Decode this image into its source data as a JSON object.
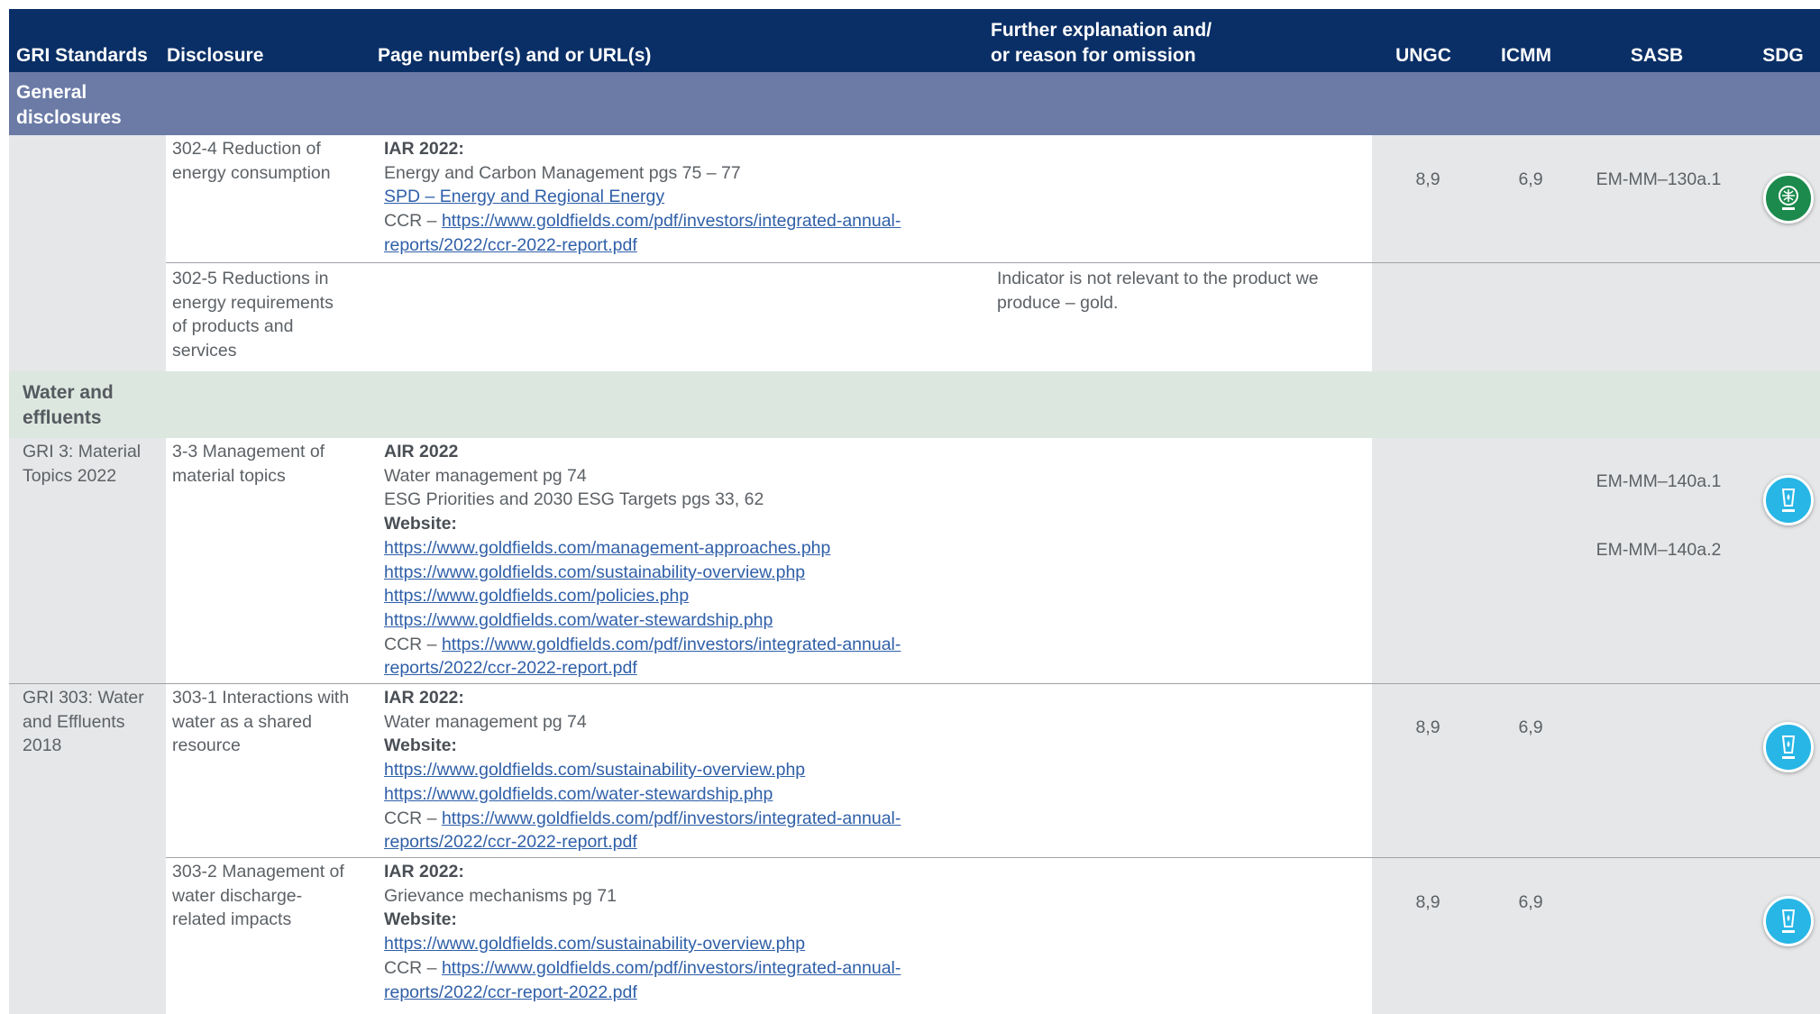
{
  "header": {
    "gri_standards": "GRI Standards",
    "disclosure": "Disclosure",
    "page_numbers": "Page number(s) and or URL(s)",
    "further_explanation_line1": "Further explanation and/",
    "further_explanation_line2": "or reason for omission",
    "ungc": "UNGC",
    "icmm": "ICMM",
    "sasb": "SASB",
    "sdg": "SDG"
  },
  "sections": {
    "general_line1": "General",
    "general_line2": "disclosures",
    "water_line1": "Water and",
    "water_line2": "effluents"
  },
  "rows": [
    {
      "disclosure": [
        "302-4 Reduction of",
        "energy consumption"
      ],
      "pages": [
        {
          "type": "bold",
          "text": "IAR 2022:"
        },
        {
          "type": "text",
          "text": "Energy and Carbon Management pgs 75 – 77"
        },
        {
          "type": "link",
          "text": "SPD – Energy and Regional Energy"
        },
        {
          "type": "ccr",
          "prefix": "CCR – ",
          "text": "https://www.goldfields.com/pdf/investors/integrated-annual-"
        },
        {
          "type": "link",
          "text": "reports/2022/ccr-2022-report.pdf"
        }
      ],
      "ungc": "8,9",
      "icmm": "6,9",
      "sasb": [
        "EM-MM–130a.1"
      ],
      "sdg_icon": "sdg-green-icon"
    },
    {
      "disclosure": [
        "302-5 Reductions in",
        "energy requirements",
        "of products and",
        "services"
      ],
      "explanation": [
        "Indicator is not relevant to the product we",
        "produce – gold."
      ]
    },
    {
      "gri": [
        "GRI 3: Material",
        "Topics 2022"
      ],
      "disclosure": [
        "3-3 Management of",
        "material topics"
      ],
      "pages": [
        {
          "type": "bold",
          "text": "AIR 2022"
        },
        {
          "type": "text",
          "text": "Water management pg 74"
        },
        {
          "type": "text",
          "text": "ESG Priorities and 2030 ESG Targets pgs 33, 62"
        },
        {
          "type": "bold",
          "text": "Website:"
        },
        {
          "type": "link",
          "text": "https://www.goldfields.com/management-approaches.php"
        },
        {
          "type": "link",
          "text": "https://www.goldfields.com/sustainability-overview.php"
        },
        {
          "type": "link",
          "text": "https://www.goldfields.com/policies.php"
        },
        {
          "type": "link",
          "text": "https://www.goldfields.com/water-stewardship.php"
        },
        {
          "type": "ccr",
          "prefix": "CCR – ",
          "text": "https://www.goldfields.com/pdf/investors/integrated-annual-"
        },
        {
          "type": "link",
          "text": "reports/2022/ccr-2022-report.pdf"
        }
      ],
      "sasb": [
        "EM-MM–140a.1",
        "EM-MM–140a.2"
      ],
      "sdg_icon": "sdg-blue-icon"
    },
    {
      "gri": [
        "GRI 303: Water",
        "and Effluents",
        "2018"
      ],
      "disclosure": [
        "303-1 Interactions with",
        "water as a shared",
        "resource"
      ],
      "pages": [
        {
          "type": "bold",
          "text": "IAR 2022:"
        },
        {
          "type": "text",
          "text": "Water management pg 74"
        },
        {
          "type": "bold",
          "text": "Website:"
        },
        {
          "type": "link",
          "text": "https://www.goldfields.com/sustainability-overview.php"
        },
        {
          "type": "link",
          "text": "https://www.goldfields.com/water-stewardship.php"
        },
        {
          "type": "ccr",
          "prefix": "CCR – ",
          "text": "https://www.goldfields.com/pdf/investors/integrated-annual-"
        },
        {
          "type": "link",
          "text": "reports/2022/ccr-2022-report.pdf"
        }
      ],
      "ungc": "8,9",
      "icmm": "6,9",
      "sdg_icon": "sdg-blue-icon"
    },
    {
      "disclosure": [
        "303-2 Management of",
        "water discharge-",
        "related impacts"
      ],
      "pages": [
        {
          "type": "bold",
          "text": "IAR 2022:"
        },
        {
          "type": "text",
          "text": "Grievance mechanisms pg 71"
        },
        {
          "type": "bold",
          "text": "Website:"
        },
        {
          "type": "link",
          "text": "https://www.goldfields.com/sustainability-overview.php"
        },
        {
          "type": "ccr",
          "prefix": "CCR – ",
          "text": "https://www.goldfields.com/pdf/investors/integrated-annual-"
        },
        {
          "type": "link",
          "text": "reports/2022/ccr-report-2022.pdf"
        }
      ],
      "ungc": "8,9",
      "icmm": "6,9",
      "sdg_icon": "sdg-blue-icon"
    }
  ],
  "colors": {
    "header_bg": "#0a2f66",
    "general_section_bg": "#6b7ba6",
    "water_section_bg": "#dce7df",
    "grey_column_bg": "#e6e7e8",
    "link": "#2f5fa8",
    "sdg_green": "#1b8a4c",
    "sdg_blue": "#27b6e6"
  }
}
